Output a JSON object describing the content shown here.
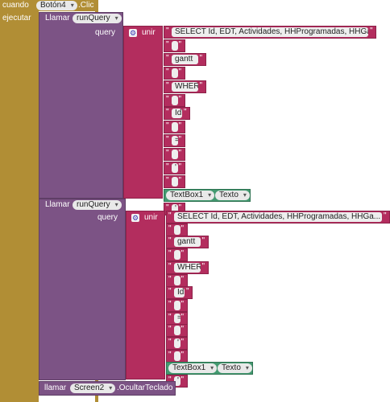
{
  "event": {
    "when_label": "cuando",
    "component": "Botón4",
    "event_name": ".Clic",
    "do_label": "ejecutar"
  },
  "call1": {
    "call_label": "Llamar",
    "method": "runQuery",
    "param_label": "query",
    "join_label": "unir",
    "items": [
      "SELECT Id, EDT, Actividades, HHProgramadas, HHGa...",
      " ",
      "gantt",
      " ",
      "WHERE",
      " ",
      "Id",
      " ",
      "=",
      " ",
      "'",
      " ",
      "",
      "'"
    ],
    "textbox": "TextBox1",
    "prop": "Texto"
  },
  "call2": {
    "call_label": "Llamar",
    "method": "runQuery",
    "param_label": "query",
    "join_label": "unir",
    "items": [
      "SELECT Id, EDT, Actividades, HHProgramadas, HHGa...",
      " ",
      "gantt",
      " ",
      "WHERE",
      " ",
      "Id",
      " ",
      "=",
      " ",
      "'",
      " ",
      "",
      "'"
    ],
    "textbox": "TextBox1",
    "prop": "Texto"
  },
  "call3": {
    "call_label": "llamar",
    "component": "Screen2",
    "method": ".OcultarTeclado"
  },
  "quote": "\"",
  "colors": {
    "event": "#b18e35",
    "procedure": "#7c5385",
    "text": "#b32d5e",
    "component": "#439970"
  }
}
